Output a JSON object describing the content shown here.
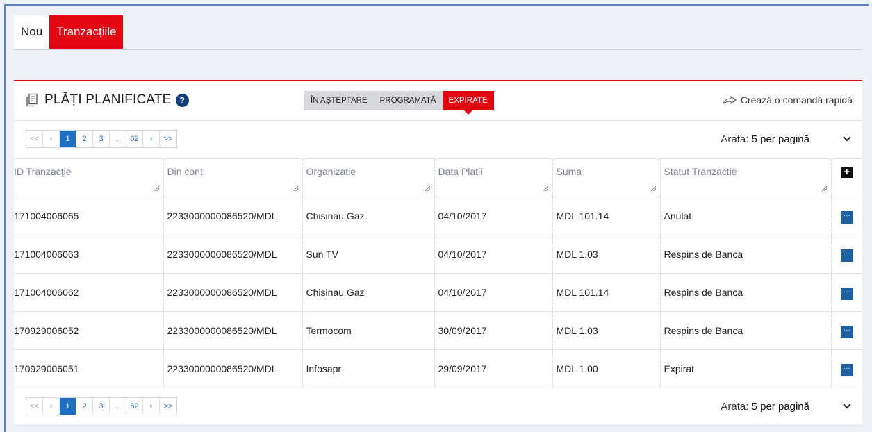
{
  "top_tabs": [
    {
      "label": "Nou"
    },
    {
      "label": "Tranzacțiile"
    }
  ],
  "panel": {
    "title": "PLĂȚI PLANIFICATE",
    "help_icon": "?",
    "status_tabs": [
      {
        "label": "ÎN AȘTEPTARE"
      },
      {
        "label": "PROGRAMATĂ"
      },
      {
        "label": "EXPIRATE"
      }
    ],
    "shortcut_label": "Crează o comandă rapidă"
  },
  "pager": {
    "first": "<<",
    "prev": "‹",
    "pages": [
      "1",
      "2",
      "3",
      "...",
      "62"
    ],
    "next": "›",
    "last": ">>",
    "current_page": 1,
    "show_label": "Arata:",
    "show_value": "5 per pagină"
  },
  "table": {
    "columns": [
      "ID Tranzacţie",
      "Din cont",
      "Organizatie",
      "Data Platii",
      "Suma",
      "Statut Tranzactie"
    ],
    "add_column_icon": "+",
    "row_action_icon": "···",
    "rows": [
      [
        "171004006065",
        "2233000000086520/MDL",
        "Chisinau Gaz",
        "04/10/2017",
        "MDL 101.14",
        "Anulat"
      ],
      [
        "171004006063",
        "2233000000086520/MDL",
        "Sun TV",
        "04/10/2017",
        "MDL 1.03",
        "Respins de Banca"
      ],
      [
        "171004006062",
        "2233000000086520/MDL",
        "Chisinau Gaz",
        "04/10/2017",
        "MDL 101.14",
        "Respins de Banca"
      ],
      [
        "170929006052",
        "2233000000086520/MDL",
        "Termocom",
        "30/09/2017",
        "MDL 1.03",
        "Respins de Banca"
      ],
      [
        "170929006051",
        "2233000000086520/MDL",
        "Infosapr",
        "29/09/2017",
        "MDL 1.00",
        "Expirat"
      ]
    ]
  },
  "colors": {
    "accent_red": "#e30613",
    "brand_blue": "#1f6fc0",
    "navy": "#0f3d7a"
  },
  "icons": {
    "title_icon": "document-icon",
    "help": "help-circle-icon",
    "shortcut": "share-arrow-icon",
    "dropdown": "chevron-down-icon"
  }
}
